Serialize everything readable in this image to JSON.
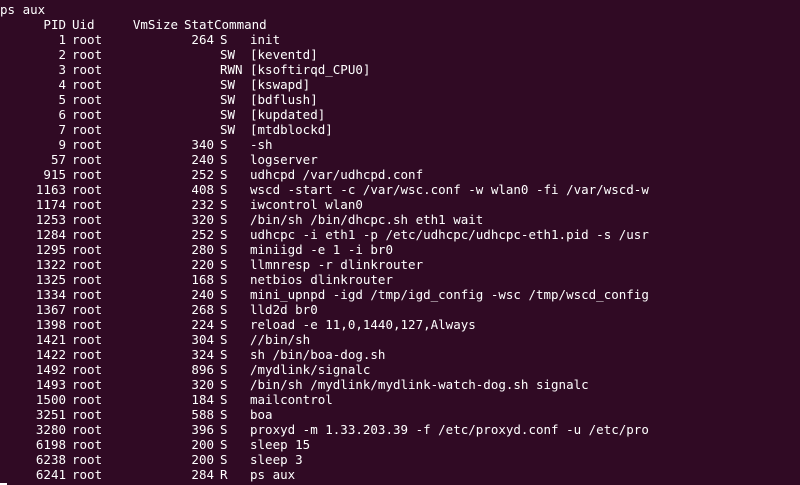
{
  "terminal": {
    "command_line": "ps aux",
    "header": {
      "pid": "PID",
      "uid": "Uid",
      "vmsize": "VmSize",
      "stat": "Stat",
      "command": "Command"
    },
    "rows": [
      {
        "pid": "1",
        "uid": "root",
        "vmsize": "264",
        "stat": "S",
        "command": "init"
      },
      {
        "pid": "2",
        "uid": "root",
        "vmsize": "",
        "stat": "SW",
        "command": "[keventd]"
      },
      {
        "pid": "3",
        "uid": "root",
        "vmsize": "",
        "stat": "RWN",
        "command": "[ksoftirqd_CPU0]"
      },
      {
        "pid": "4",
        "uid": "root",
        "vmsize": "",
        "stat": "SW",
        "command": "[kswapd]"
      },
      {
        "pid": "5",
        "uid": "root",
        "vmsize": "",
        "stat": "SW",
        "command": "[bdflush]"
      },
      {
        "pid": "6",
        "uid": "root",
        "vmsize": "",
        "stat": "SW",
        "command": "[kupdated]"
      },
      {
        "pid": "7",
        "uid": "root",
        "vmsize": "",
        "stat": "SW",
        "command": "[mtdblockd]"
      },
      {
        "pid": "9",
        "uid": "root",
        "vmsize": "340",
        "stat": "S",
        "command": "-sh"
      },
      {
        "pid": "57",
        "uid": "root",
        "vmsize": "240",
        "stat": "S",
        "command": "logserver"
      },
      {
        "pid": "915",
        "uid": "root",
        "vmsize": "252",
        "stat": "S",
        "command": "udhcpd /var/udhcpd.conf"
      },
      {
        "pid": "1163",
        "uid": "root",
        "vmsize": "408",
        "stat": "S",
        "command": "wscd -start -c /var/wsc.conf -w wlan0 -fi /var/wscd-w"
      },
      {
        "pid": "1174",
        "uid": "root",
        "vmsize": "232",
        "stat": "S",
        "command": "iwcontrol wlan0"
      },
      {
        "pid": "1253",
        "uid": "root",
        "vmsize": "320",
        "stat": "S",
        "command": "/bin/sh /bin/dhcpc.sh eth1 wait"
      },
      {
        "pid": "1284",
        "uid": "root",
        "vmsize": "252",
        "stat": "S",
        "command": "udhcpc -i eth1 -p /etc/udhcpc/udhcpc-eth1.pid -s /usr"
      },
      {
        "pid": "1295",
        "uid": "root",
        "vmsize": "280",
        "stat": "S",
        "command": "miniigd -e 1 -i br0"
      },
      {
        "pid": "1322",
        "uid": "root",
        "vmsize": "220",
        "stat": "S",
        "command": "llmnresp -r dlinkrouter"
      },
      {
        "pid": "1325",
        "uid": "root",
        "vmsize": "168",
        "stat": "S",
        "command": "netbios dlinkrouter"
      },
      {
        "pid": "1334",
        "uid": "root",
        "vmsize": "240",
        "stat": "S",
        "command": "mini_upnpd -igd /tmp/igd_config -wsc /tmp/wscd_config"
      },
      {
        "pid": "1367",
        "uid": "root",
        "vmsize": "268",
        "stat": "S",
        "command": "lld2d br0"
      },
      {
        "pid": "1398",
        "uid": "root",
        "vmsize": "224",
        "stat": "S",
        "command": "reload -e 11,0,1440,127,Always"
      },
      {
        "pid": "1421",
        "uid": "root",
        "vmsize": "304",
        "stat": "S",
        "command": "//bin/sh"
      },
      {
        "pid": "1422",
        "uid": "root",
        "vmsize": "324",
        "stat": "S",
        "command": "sh /bin/boa-dog.sh"
      },
      {
        "pid": "1492",
        "uid": "root",
        "vmsize": "896",
        "stat": "S",
        "command": "/mydlink/signalc"
      },
      {
        "pid": "1493",
        "uid": "root",
        "vmsize": "320",
        "stat": "S",
        "command": "/bin/sh /mydlink/mydlink-watch-dog.sh signalc"
      },
      {
        "pid": "1500",
        "uid": "root",
        "vmsize": "184",
        "stat": "S",
        "command": "mailcontrol"
      },
      {
        "pid": "3251",
        "uid": "root",
        "vmsize": "588",
        "stat": "S",
        "command": "boa"
      },
      {
        "pid": "3280",
        "uid": "root",
        "vmsize": "396",
        "stat": "S",
        "command": "proxyd -m 1.33.203.39 -f /etc/proxyd.conf -u /etc/pro"
      },
      {
        "pid": "6198",
        "uid": "root",
        "vmsize": "200",
        "stat": "S",
        "command": "sleep 15"
      },
      {
        "pid": "6238",
        "uid": "root",
        "vmsize": "200",
        "stat": "S",
        "command": "sleep 3"
      },
      {
        "pid": "6241",
        "uid": "root",
        "vmsize": "284",
        "stat": "R",
        "command": "ps aux"
      }
    ],
    "colors": {
      "background": "#300a24",
      "foreground": "#ffffff"
    }
  }
}
